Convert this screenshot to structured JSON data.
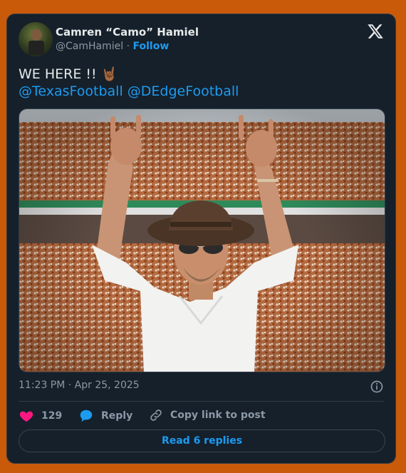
{
  "author": {
    "display_name": "Camren “Camo” Hamiel",
    "handle": "@CamHamiel",
    "separator": "·",
    "follow_label": "Follow"
  },
  "tweet": {
    "text": "WE HERE !! 🤘🏾",
    "mentions": [
      "@TexasFootball",
      "@DEdgeFootball"
    ]
  },
  "timestamp": "11:23 PM · Apr 25, 2025",
  "actions": {
    "like_count": "129",
    "reply_label": "Reply",
    "copy_link_label": "Copy link to post"
  },
  "read_replies_label": "Read 6 replies",
  "icons": [
    "x-logo-icon",
    "heart-icon",
    "reply-bubble-icon",
    "link-icon",
    "info-icon"
  ],
  "colors": {
    "page_background": "#c85a0a",
    "card_background": "#15202b",
    "accent_blue": "#1d9bf0",
    "like_pink": "#f91880",
    "muted_text": "#8b98a5"
  }
}
